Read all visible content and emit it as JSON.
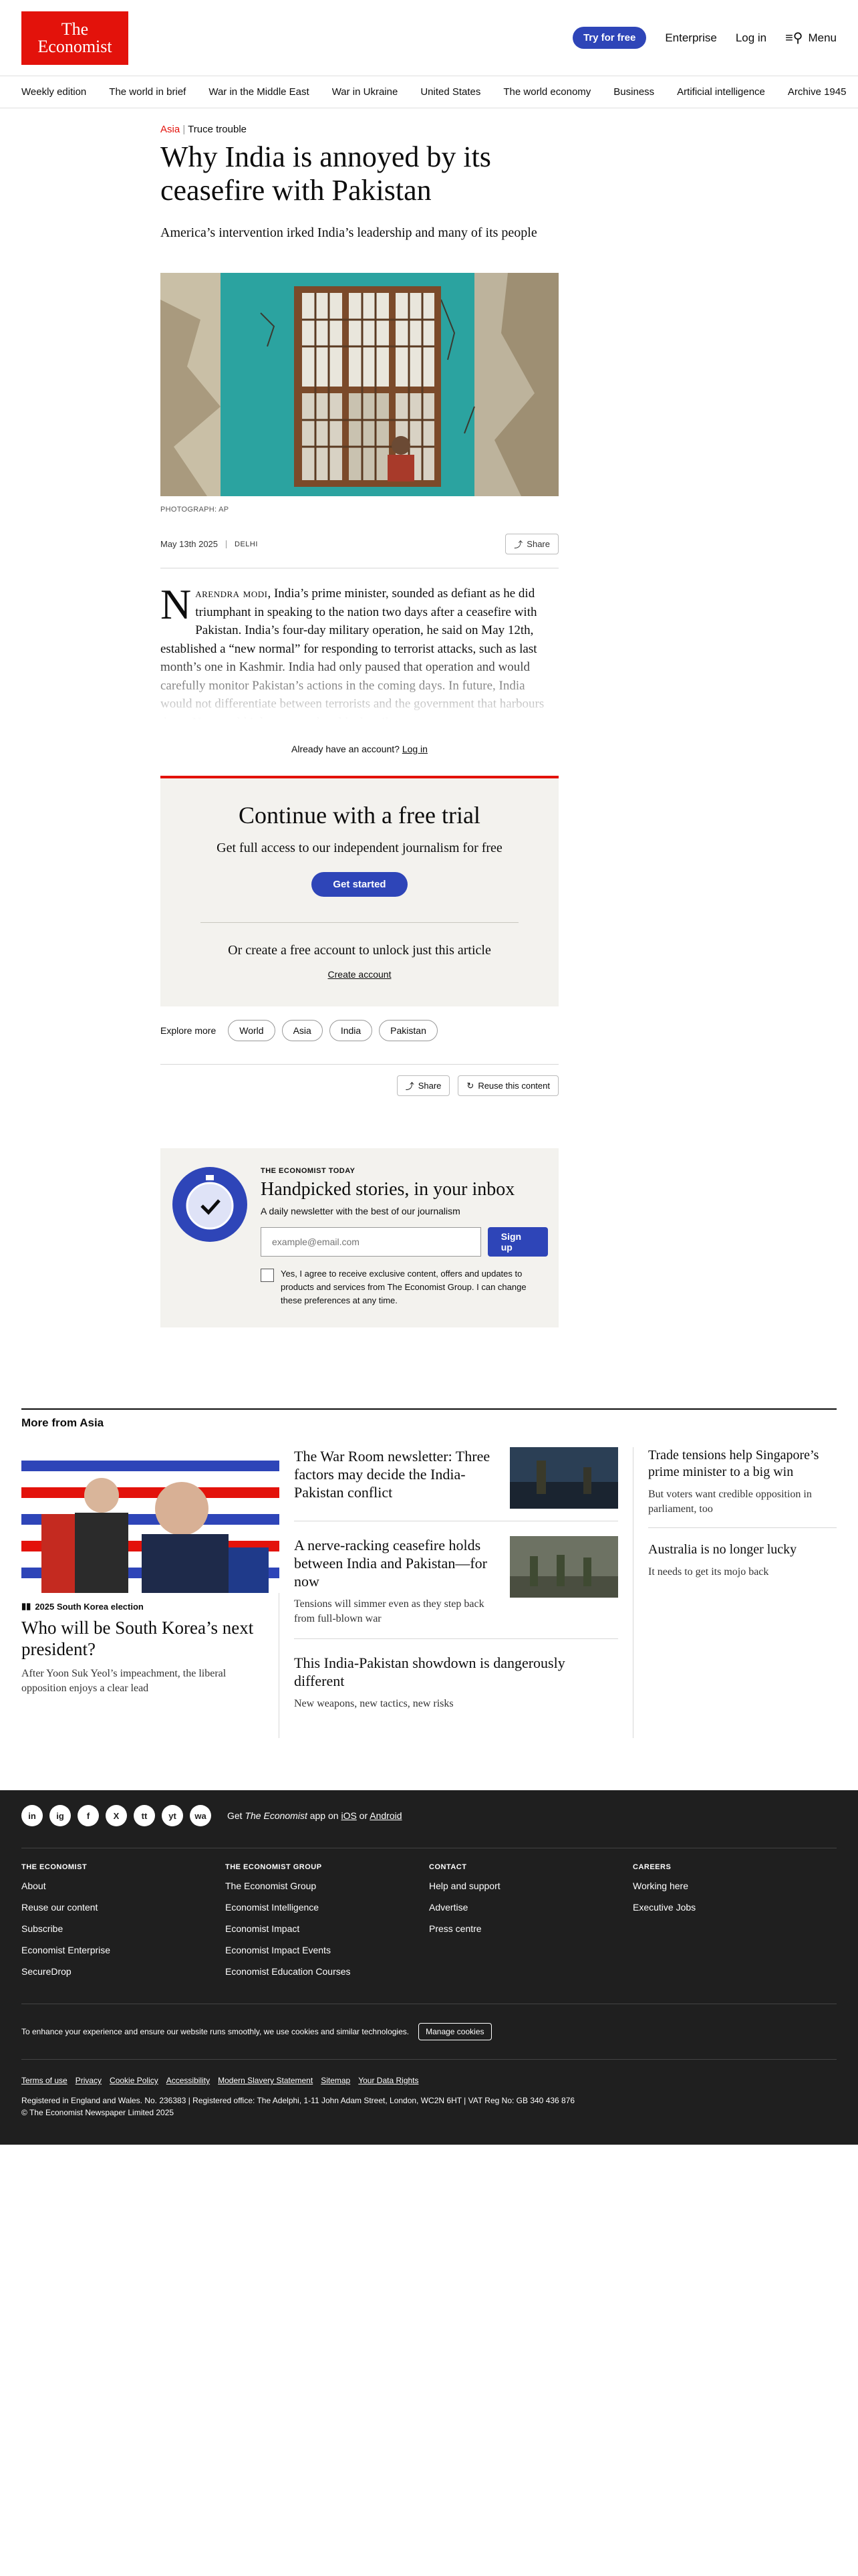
{
  "header": {
    "logo_line1": "The",
    "logo_line2": "Economist",
    "try_label": "Try for free",
    "enterprise": "Enterprise",
    "login": "Log in",
    "menu": "Menu"
  },
  "nav": [
    "Weekly edition",
    "The world in brief",
    "War in the Middle East",
    "War in Ukraine",
    "United States",
    "The world economy",
    "Business",
    "Artificial intelligence",
    "Archive 1945"
  ],
  "article": {
    "section": "Asia",
    "rubric_sep": "|",
    "fly": "Truce trouble",
    "headline": "Why India is annoyed by its ceasefire with Pakistan",
    "standfirst": "America’s intervention irked India’s leadership and many of its people",
    "caption": "PHOTOGRAPH: AP",
    "date": "May 13th 2025",
    "dateline": "DELHI",
    "share": "Share",
    "dropcap": "N",
    "smallcaps": "arendra modi",
    "body": ", India’s prime minister, sounded as defiant as he did triumphant in speaking to the nation two days after a ceasefire with Pakistan. India’s four-day military operation, he said on May 12th, established a “new normal” for responding to terrorist attacks, such as last month’s one in Kashmir. India had only paused that operation and would carefully monitor Pakistan’s actions in the coming days. In future, India would not differentiate between terrorists and the government that harbours them. Nor would it bow to nuclear blackmail.",
    "account_q": "Already have an account?",
    "account_login": "Log in"
  },
  "paywall": {
    "title": "Continue with a free trial",
    "sub": "Get full access to our independent journalism for free",
    "cta": "Get started",
    "or": "Or create a free account to unlock just this article",
    "create": "Create account"
  },
  "explore": {
    "label": "Explore more",
    "chips": [
      "World",
      "Asia",
      "India",
      "Pakistan"
    ]
  },
  "actions": {
    "share": "Share",
    "reuse": "Reuse this content"
  },
  "newsletter": {
    "kicker": "THE ECONOMIST TODAY",
    "title": "Handpicked stories, in your inbox",
    "desc": "A daily newsletter with the best of our journalism",
    "placeholder": "example@email.com",
    "signup": "Sign up",
    "consent": "Yes, I agree to receive exclusive content, offers and updates to products and services from The Economist Group. I can change these preferences at any time."
  },
  "more": {
    "title": "More from Asia",
    "lead": {
      "fly": "2025 South Korea election",
      "headline": "Who will be South Korea’s next president?",
      "dek": "After Yoon Suk Yeol’s impeachment, the liberal opposition enjoys a clear lead"
    },
    "cards": [
      {
        "headline": "The War Room newsletter: Three factors may decide the India-Pakistan conflict",
        "dek": ""
      },
      {
        "headline": "A nerve-racking ceasefire holds between India and Pakistan—for now",
        "dek": "Tensions will simmer even as they step back from full-blown war"
      },
      {
        "headline": "This India-Pakistan showdown is dangerously different",
        "dek": "New weapons, new tactics, new risks"
      }
    ],
    "small": [
      {
        "headline": "Trade tensions help Singapore’s prime minister to a big win",
        "dek": "But voters want credible opposition in parliament, too"
      },
      {
        "headline": "Australia is no longer lucky",
        "dek": "It needs to get its mojo back"
      }
    ]
  },
  "footer": {
    "social": [
      "in",
      "ig",
      "f",
      "X",
      "tt",
      "yt",
      "wa"
    ],
    "app_pre": "Get ",
    "app_brand": "The Economist",
    "app_mid": " app on ",
    "app_ios": "iOS",
    "app_or": " or ",
    "app_android": "Android",
    "columns": [
      {
        "title": "THE ECONOMIST",
        "items": [
          "About",
          "Reuse our content",
          "Subscribe",
          "Economist Enterprise",
          "SecureDrop"
        ]
      },
      {
        "title": "THE ECONOMIST GROUP",
        "items": [
          "The Economist Group",
          "Economist Intelligence",
          "Economist Impact",
          "Economist Impact Events",
          "Economist Education Courses"
        ]
      },
      {
        "title": "CONTACT",
        "items": [
          "Help and support",
          "Advertise",
          "Press centre"
        ]
      },
      {
        "title": "CAREERS",
        "items": [
          "Working here",
          "Executive Jobs"
        ]
      }
    ],
    "cookie_text": "To enhance your experience and ensure our website runs smoothly, we use cookies and similar technologies.",
    "manage": "Manage cookies",
    "legal": [
      "Terms of use",
      "Privacy",
      "Cookie Policy",
      "Accessibility",
      "Modern Slavery Statement",
      "Sitemap",
      "Your Data Rights"
    ],
    "registered": "Registered in England and Wales. No. 236383 | Registered office: The Adelphi, 1-11 John Adam Street, London, WC2N 6HT | VAT Reg No: GB 340 436 876",
    "copyright": "© The Economist Newspaper Limited 2025"
  },
  "colors": {
    "red": "#e3120b",
    "blue": "#2e45b8",
    "footer": "#1f1f1f",
    "panel": "#f3f2ee"
  }
}
